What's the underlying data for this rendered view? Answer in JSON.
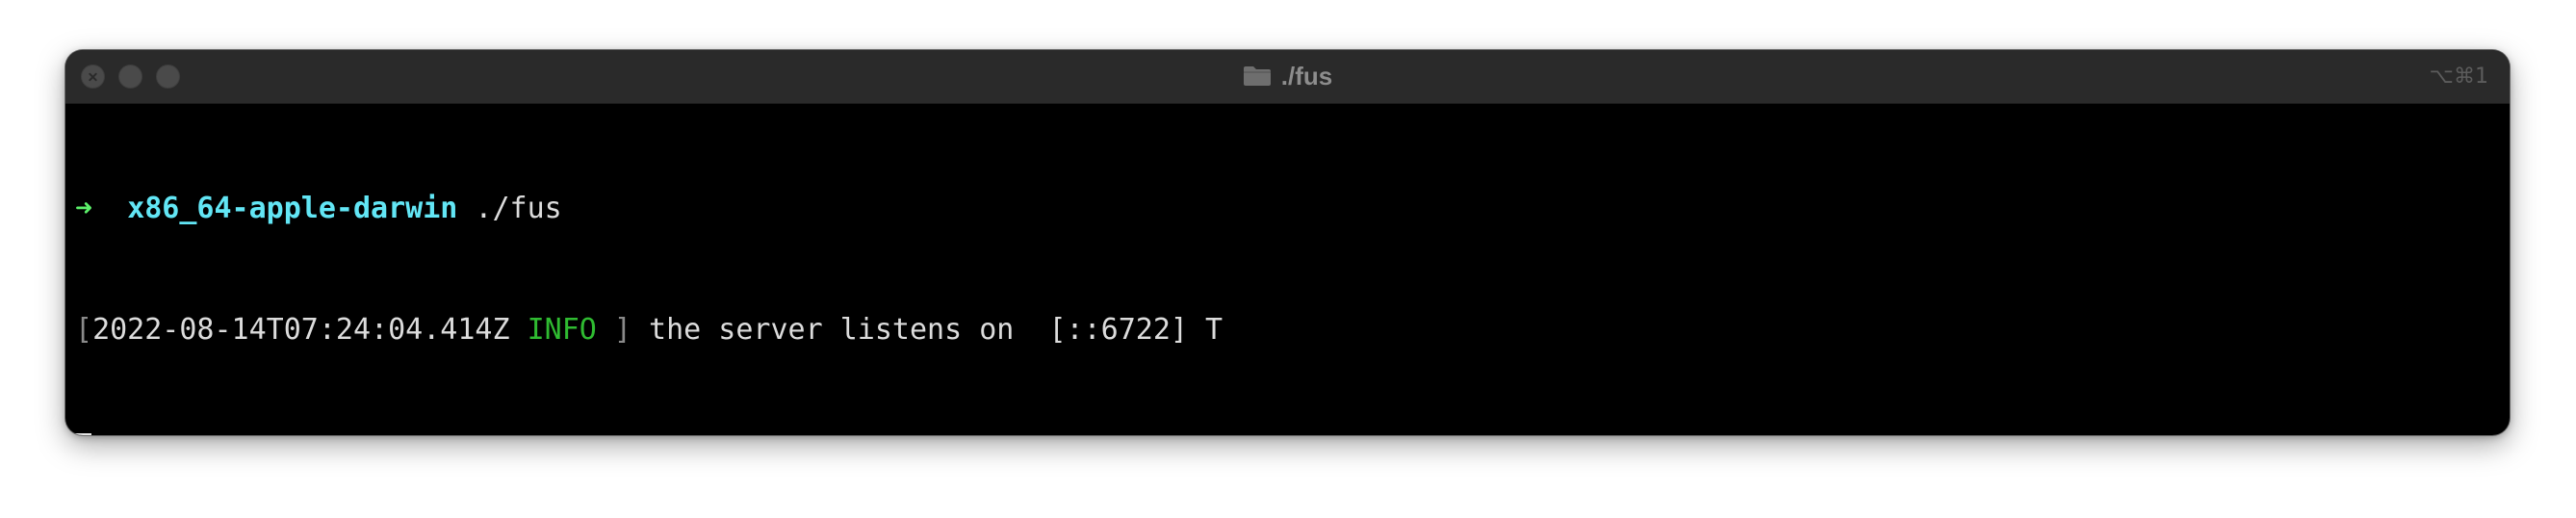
{
  "window": {
    "title": "./fus",
    "shortcut": "⌥⌘1",
    "folder_icon": "folder-icon",
    "traffic_lights": [
      "close",
      "minimize",
      "zoom"
    ]
  },
  "terminal": {
    "prompt": {
      "arrow": "➜",
      "host": "x86_64-apple-darwin",
      "command": "./fus"
    },
    "log": {
      "open_bracket": "[",
      "timestamp": "2022-08-14T07:24:04.414Z",
      "level": "INFO",
      "close_bracket": "]",
      "message": "the server listens on  [::6722] T"
    }
  },
  "colors": {
    "background": "#000000",
    "titlebar": "#2a2a2a",
    "prompt_arrow": "#5cf06a",
    "host": "#62e6f5",
    "info_level": "#2fbb31",
    "text": "#dcdcdc"
  }
}
